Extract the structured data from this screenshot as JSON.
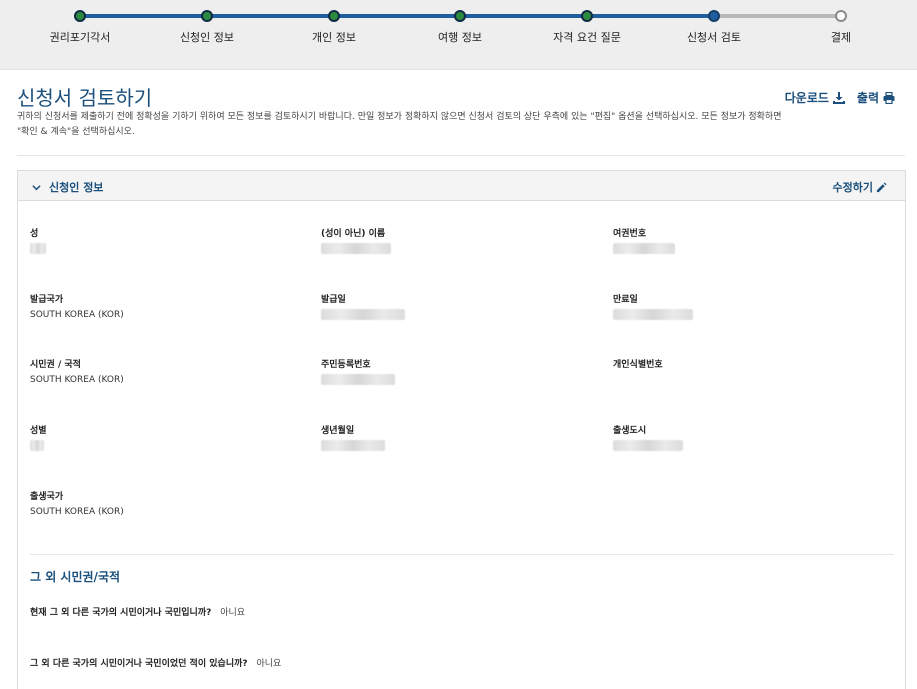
{
  "progress": {
    "steps": [
      {
        "label": "권리포기각서"
      },
      {
        "label": "신청인 정보"
      },
      {
        "label": "개인 정보"
      },
      {
        "label": "여행 정보"
      },
      {
        "label": "자격 요건 질문"
      },
      {
        "label": "신청서 검토"
      },
      {
        "label": "결제"
      }
    ],
    "completed_fraction": 0.833
  },
  "page": {
    "title": "신청서 검토하기",
    "intro": "귀하의 신청서를 제출하기 전에 정확성을 기하기 위하여 모든 정보를 검토하시기 바랍니다. 만일 정보가 정확하지 않으면 신청서 검토의 상단 우측에 있는 \"편집\" 옵션을 선택하십시오. 모든 정보가 정확하면 \"확인 & 계속\"을 선택하십시오.",
    "download_label": "다운로드",
    "print_label": "출력"
  },
  "section": {
    "title": "신청인 정보",
    "edit_label": "수정하기",
    "fields": {
      "surname_label": "성",
      "given_name_label": "(성이 아닌) 이름",
      "passport_label": "여권번호",
      "issuing_country_label": "발급국가",
      "issuing_country_value": "SOUTH KOREA (KOR)",
      "issue_date_label": "발급일",
      "expiry_label": "만료일",
      "citizenship_label": "시민권 / 국적",
      "citizenship_value": "SOUTH KOREA (KOR)",
      "national_id_label": "주민등록번호",
      "personal_id_label": "개인식별번호",
      "gender_label": "성별",
      "dob_label": "생년월일",
      "birth_city_label": "출생도시",
      "birth_country_label": "출생국가",
      "birth_country_value": "SOUTH KOREA (KOR)"
    },
    "other_citizenship": {
      "title": "그 외 시민권/국적",
      "q1": "현재 그 외 다른 국가의 시민이거나 국민입니까?",
      "a1": "아니요",
      "q2": "그 외 다른 국가의 시민이거나 국민이었던 적이 있습니까?",
      "a2": "아니요"
    }
  },
  "icons": {
    "download": "download-icon",
    "print": "print-icon",
    "edit": "pencil-icon",
    "collapse": "chevron-down-icon"
  },
  "colors": {
    "accent": "#1b4f7c",
    "track_done": "#1f5f9e",
    "step_done": "#2b8a3e"
  }
}
